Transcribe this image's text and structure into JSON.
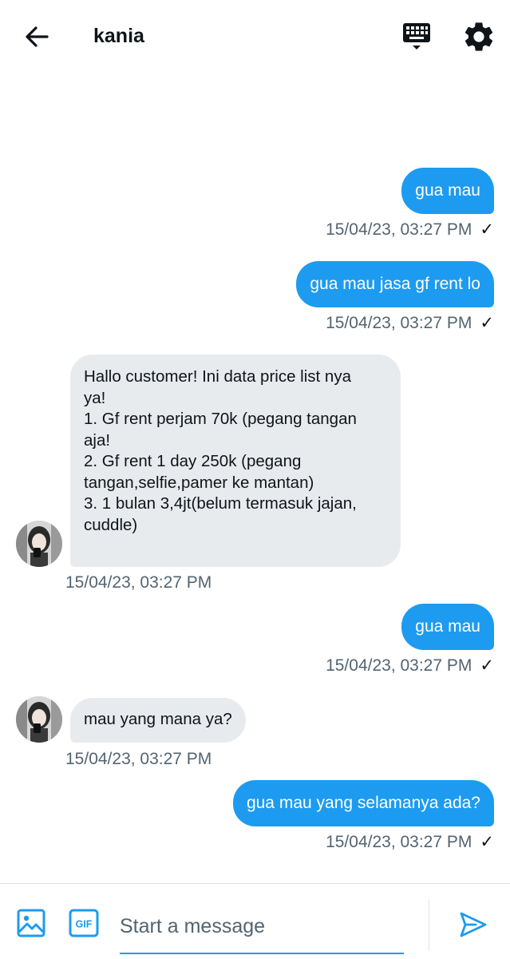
{
  "header": {
    "title": "kania",
    "back_icon": "arrow-left-icon",
    "keyboard_icon": "keyboard-icon",
    "settings_icon": "gear-icon"
  },
  "messages": [
    {
      "direction": "sent",
      "text": "gua mau",
      "timestamp": "15/04/23, 03:27 PM",
      "status": "✓"
    },
    {
      "direction": "sent",
      "text": "gua mau jasa gf rent lo",
      "timestamp": "15/04/23, 03:27 PM",
      "status": "✓"
    },
    {
      "direction": "received",
      "lines": [
        "Hallo customer! Ini data price list nya",
        "ya!",
        "1. Gf rent perjam 70k (pegang tangan",
        "aja!",
        "2. Gf rent 1 day 250k (pegang",
        "tangan,selfie,pamer ke mantan)",
        "3. 1 bulan 3,4jt(belum termasuk jajan,",
        "cuddle)"
      ],
      "timestamp": "15/04/23, 03:27 PM"
    },
    {
      "direction": "sent",
      "text": "gua mau",
      "timestamp": "15/04/23, 03:27 PM",
      "status": "✓"
    },
    {
      "direction": "received",
      "text": "mau yang mana ya?",
      "timestamp": "15/04/23, 03:27 PM"
    },
    {
      "direction": "sent",
      "text": "gua mau yang selamanya ada?",
      "timestamp": "15/04/23, 03:27 PM",
      "status": "✓"
    }
  ],
  "composer": {
    "placeholder": "Start a message",
    "value": "",
    "media_icon": "image-icon",
    "gif_icon": "gif-icon",
    "send_icon": "send-icon"
  },
  "colors": {
    "accent": "#1d9bf0",
    "received_bubble": "#e8ebee",
    "timestamp": "#536471",
    "text": "#0f1419"
  }
}
